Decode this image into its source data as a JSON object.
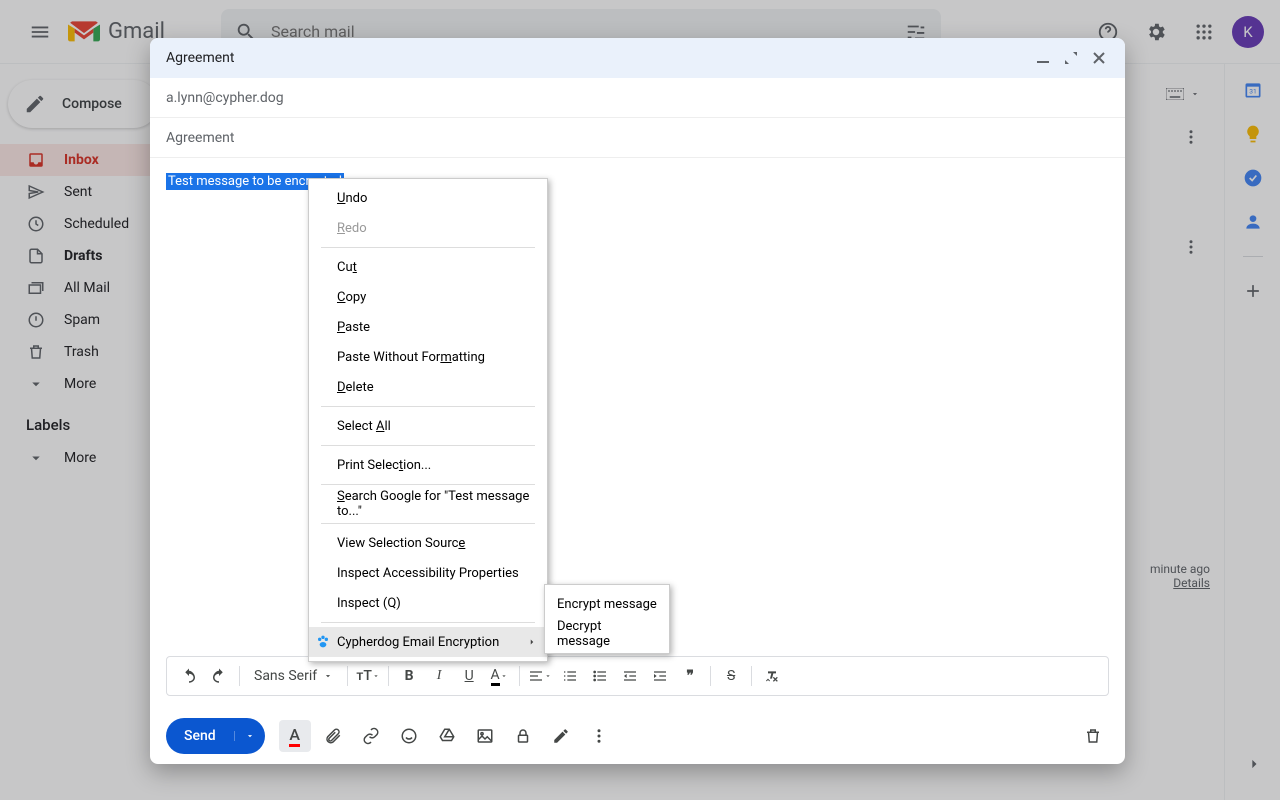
{
  "header": {
    "app_name": "Gmail",
    "search_placeholder": "Search mail",
    "avatar_initial": "K"
  },
  "sidebar": {
    "compose_label": "Compose",
    "items": [
      {
        "label": "Inbox",
        "icon": "inbox",
        "active": true
      },
      {
        "label": "Sent",
        "icon": "send"
      },
      {
        "label": "Scheduled",
        "icon": "schedule"
      },
      {
        "label": "Drafts",
        "icon": "draft",
        "bold": true
      },
      {
        "label": "All Mail",
        "icon": "stacked"
      },
      {
        "label": "Spam",
        "icon": "report"
      },
      {
        "label": "Trash",
        "icon": "trash"
      },
      {
        "label": "More",
        "icon": "expand"
      }
    ],
    "labels_header": "Labels",
    "labels_more": "More"
  },
  "compose": {
    "title": "Agreement",
    "recipient": "a.lynn@cypher.dog",
    "subject": "Agreement",
    "body_selected": "Test message to be encrypted",
    "font_name": "Sans Serif",
    "send_label": "Send"
  },
  "context_menu": {
    "items": [
      {
        "label_pre": "",
        "underline": "U",
        "label_post": "ndo"
      },
      {
        "label_pre": "",
        "underline": "R",
        "label_post": "edo",
        "disabled": true
      },
      {
        "sep": true
      },
      {
        "label_pre": "Cu",
        "underline": "t",
        "label_post": ""
      },
      {
        "label_pre": "",
        "underline": "C",
        "label_post": "opy"
      },
      {
        "label_pre": "",
        "underline": "P",
        "label_post": "aste"
      },
      {
        "label_pre": "Paste Without For",
        "underline": "m",
        "label_post": "atting"
      },
      {
        "label_pre": "",
        "underline": "D",
        "label_post": "elete"
      },
      {
        "sep": true
      },
      {
        "label_pre": "Select ",
        "underline": "A",
        "label_post": "ll"
      },
      {
        "sep": true
      },
      {
        "label_pre": "Print Selec",
        "underline": "t",
        "label_post": "ion..."
      },
      {
        "sep": true
      },
      {
        "label_pre": "",
        "underline": "S",
        "label_post": "earch Google for \"Test message to...\""
      },
      {
        "sep": true
      },
      {
        "label_pre": "View Selection Sourc",
        "underline": "e",
        "label_post": ""
      },
      {
        "label_pre": "Inspect Accessibility Properties",
        "underline": "",
        "label_post": ""
      },
      {
        "label_pre": "Inspect (Q)",
        "underline": "",
        "label_post": ""
      },
      {
        "sep": true
      },
      {
        "label_pre": "Cypherdog Email Encryption",
        "underline": "",
        "label_post": "",
        "icon": "paw",
        "submenu": true,
        "highlighted": true
      }
    ],
    "submenu": {
      "items": [
        {
          "label": "Encrypt message"
        },
        {
          "label": "Decrypt message"
        }
      ]
    }
  },
  "status": {
    "last_activity": "minute ago",
    "details": "Details"
  }
}
